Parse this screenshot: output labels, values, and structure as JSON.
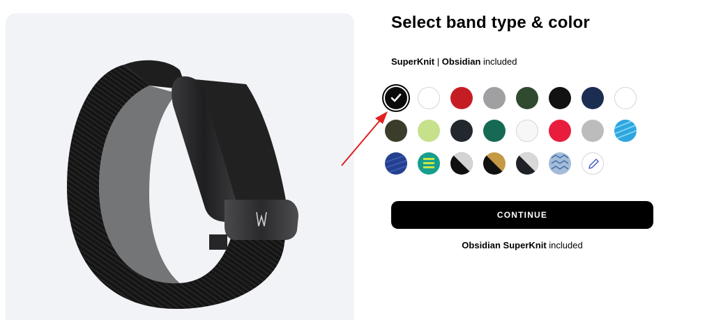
{
  "header": {
    "title": "Select band type & color"
  },
  "selection": {
    "band_type": "SuperKnit",
    "separator": "|",
    "color": "Obsidian",
    "suffix": "included"
  },
  "swatches": [
    {
      "name": "Obsidian",
      "color": "#0b0b0b",
      "selected": true,
      "icon": "check-icon"
    },
    {
      "name": "White",
      "color": "#ffffff"
    },
    {
      "name": "Red",
      "color": "#c41e24"
    },
    {
      "name": "Grey",
      "color": "#a0a0a2"
    },
    {
      "name": "Forest",
      "color": "#2f4a2f"
    },
    {
      "name": "Black",
      "color": "#121212"
    },
    {
      "name": "Navy",
      "color": "#1c2d52"
    },
    {
      "name": "Ivory",
      "color": "#ffffff"
    },
    {
      "name": "Olive",
      "color": "#3b3d2a"
    },
    {
      "name": "Lime",
      "color": "#c6e08c"
    },
    {
      "name": "Charcoal",
      "color": "#23272e"
    },
    {
      "name": "Teal",
      "color": "#166a54"
    },
    {
      "name": "Pearl",
      "color": "#f7f7f7"
    },
    {
      "name": "Crimson",
      "color": "#e81c3d"
    },
    {
      "name": "Silver",
      "color": "#bcbcbc"
    },
    {
      "name": "Sky",
      "color": "#2ea6df"
    },
    {
      "name": "Royal",
      "color": "#24408e"
    },
    {
      "name": "Jade Stripe",
      "color": "#179f8c"
    },
    {
      "name": "Black Silver",
      "color": "#101010"
    },
    {
      "name": "Black Gold",
      "color": "#c49a45"
    },
    {
      "name": "Grey Black",
      "color": "#1e2126"
    },
    {
      "name": "Blue Pattern",
      "color": "#a5bcd8"
    },
    {
      "name": "Custom",
      "color": "#ffffff",
      "icon": "pencil-icon"
    }
  ],
  "cta": {
    "label": "CONTINUE"
  },
  "summary": {
    "color": "Obsidian",
    "band_type": "SuperKnit",
    "suffix": "included"
  },
  "accent": {
    "arrow": "#e02020"
  }
}
